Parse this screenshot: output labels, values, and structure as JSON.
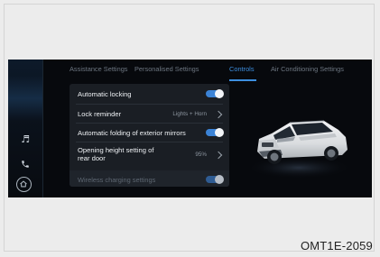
{
  "tabs": [
    {
      "label": "Assistance Settings"
    },
    {
      "label": "Personalised Settings"
    },
    {
      "label": "Controls"
    },
    {
      "label": "Air Conditioning Settings"
    }
  ],
  "active_tab_index": 2,
  "settings": {
    "automatic_locking": {
      "label": "Automatic locking",
      "enabled": true
    },
    "lock_reminder": {
      "label": "Lock reminder",
      "value": "Lights + Horn"
    },
    "auto_fold_mirrors": {
      "label": "Automatic folding of exterior mirrors",
      "enabled": true
    },
    "rear_door_height": {
      "label_line1": "Opening height setting of",
      "label_line2": "rear door",
      "value": "95%"
    },
    "wireless_charging": {
      "label": "Wireless charging settings",
      "enabled": true
    }
  },
  "side_rail": {
    "icons": [
      "music-icon",
      "phone-icon",
      "home-icon"
    ]
  },
  "caption": "OMT1E-2059",
  "colors": {
    "accent": "#3d8fe0",
    "screen_bg": "#07090d",
    "panel_bg": "#1a1e24"
  }
}
